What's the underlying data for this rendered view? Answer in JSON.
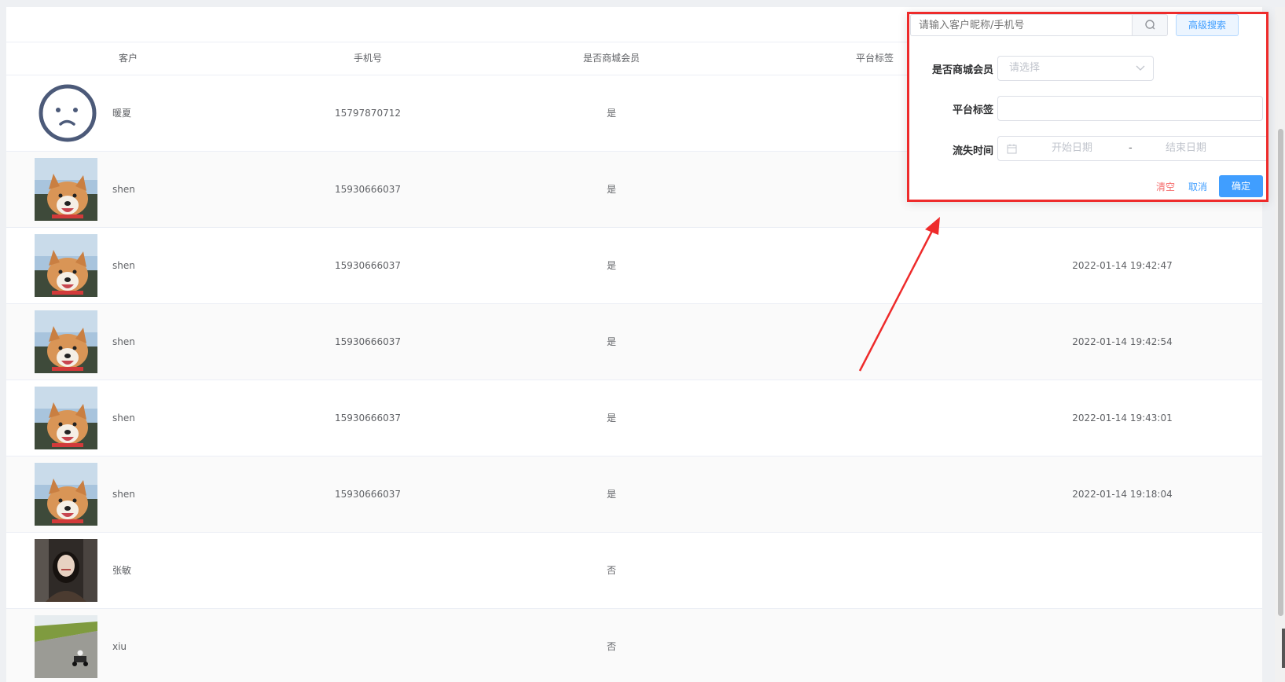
{
  "table": {
    "headers": {
      "customer": "客户",
      "phone": "手机号",
      "member": "是否商城会员",
      "tag": "平台标签"
    },
    "rows": [
      {
        "avatar": "sad-face-avatar",
        "name": "暖夏",
        "phone": "15797870712",
        "member": "是",
        "time": ""
      },
      {
        "avatar": "dog-photo-avatar",
        "name": "shen",
        "phone": "15930666037",
        "member": "是",
        "time": ""
      },
      {
        "avatar": "dog-photo-avatar",
        "name": "shen",
        "phone": "15930666037",
        "member": "是",
        "time": "2022-01-14 19:42:47"
      },
      {
        "avatar": "dog-photo-avatar",
        "name": "shen",
        "phone": "15930666037",
        "member": "是",
        "time": "2022-01-14 19:42:54"
      },
      {
        "avatar": "dog-photo-avatar",
        "name": "shen",
        "phone": "15930666037",
        "member": "是",
        "time": "2022-01-14 19:43:01"
      },
      {
        "avatar": "dog-photo-avatar",
        "name": "shen",
        "phone": "15930666037",
        "member": "是",
        "time": "2022-01-14 19:18:04"
      },
      {
        "avatar": "woman-photo-avatar",
        "name": "张敏",
        "phone": "",
        "member": "否",
        "time": ""
      },
      {
        "avatar": "kart-photo-avatar",
        "name": "xiu",
        "phone": "",
        "member": "否",
        "time": ""
      }
    ]
  },
  "search": {
    "placeholder": "请输入客户昵称/手机号",
    "advanced_label": "高级搜索",
    "icon": "search-icon"
  },
  "filter": {
    "member_label": "是否商城会员",
    "member_placeholder": "请选择",
    "tag_label": "平台标签",
    "tag_value": "",
    "lost_time_label": "流失时间",
    "start_placeholder": "开始日期",
    "separator": "-",
    "end_placeholder": "结束日期",
    "clear_label": "清空",
    "cancel_label": "取消",
    "confirm_label": "确定"
  },
  "colors": {
    "annotation_red": "#ee2b2b",
    "primary": "#409eff",
    "danger": "#f56c6c"
  }
}
